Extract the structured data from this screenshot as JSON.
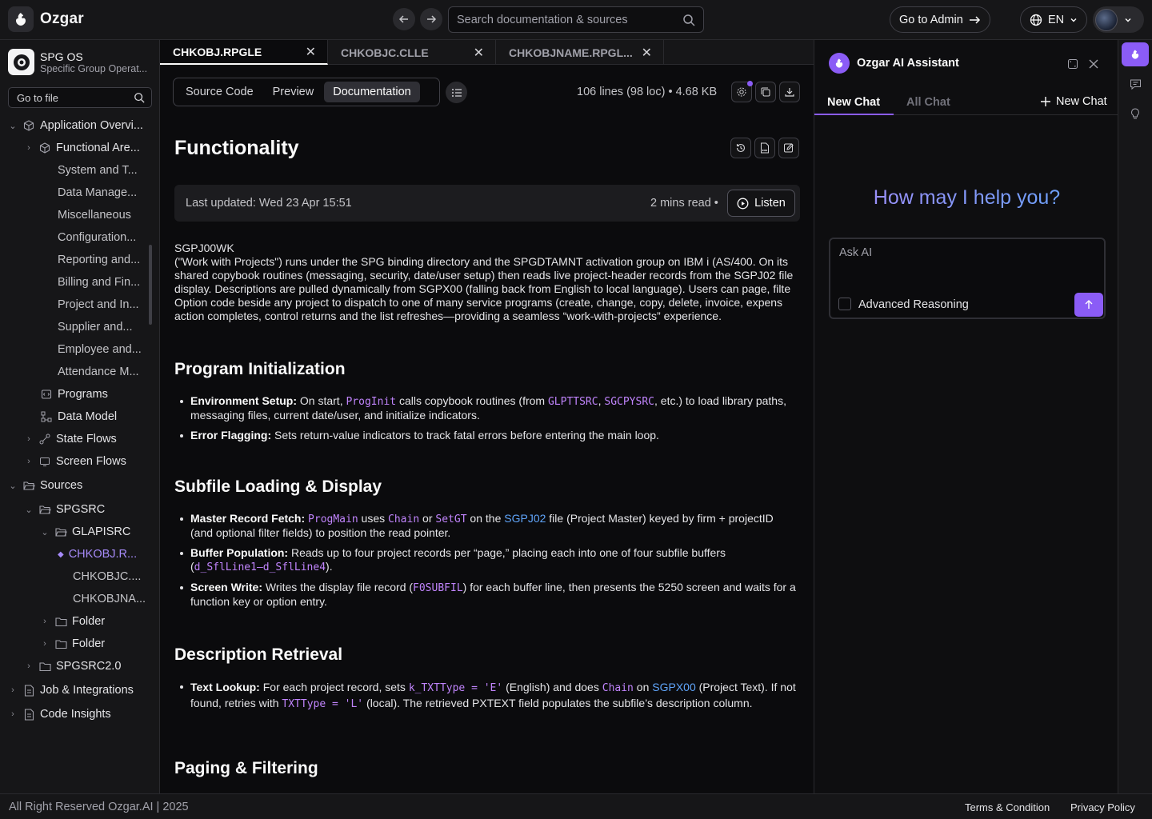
{
  "topbar": {
    "brand": "Ozgar",
    "search_placeholder": "Search documentation & sources",
    "admin_label": "Go to Admin",
    "lang_label": "EN"
  },
  "sidebar": {
    "project_title": "SPG OS",
    "project_subtitle": "Specific Group Operat...",
    "file_search_placeholder": "Go to file",
    "tree": [
      {
        "label": "Application Overvi...",
        "icon": "box-icon"
      },
      {
        "label": "Functional Are...",
        "icon": "box-icon"
      },
      {
        "label": "System and T..."
      },
      {
        "label": "Data Manage..."
      },
      {
        "label": "Miscellaneous"
      },
      {
        "label": "Configuration..."
      },
      {
        "label": "Reporting and..."
      },
      {
        "label": "Billing and Fin..."
      },
      {
        "label": "Project and In..."
      },
      {
        "label": "Supplier and..."
      },
      {
        "label": "Employee and..."
      },
      {
        "label": "Attendance M..."
      },
      {
        "label": "Programs",
        "icon": "code-file-icon"
      },
      {
        "label": "Data Model",
        "icon": "data-model-icon"
      },
      {
        "label": "State Flows",
        "icon": "state-flow-icon"
      },
      {
        "label": "Screen Flows",
        "icon": "screen-flow-icon"
      },
      {
        "label": "Sources",
        "icon": "folder-open-icon"
      },
      {
        "label": "SPGSRC",
        "icon": "folder-open-icon"
      },
      {
        "label": "GLAPISRC",
        "icon": "folder-open-icon"
      },
      {
        "label": "CHKOBJ.R..."
      },
      {
        "label": "CHKOBJC...."
      },
      {
        "label": "CHKOBJNA..."
      },
      {
        "label": "Folder",
        "icon": "folder-icon"
      },
      {
        "label": "Folder",
        "icon": "folder-icon"
      },
      {
        "label": "SPGSRC2.0",
        "icon": "folder-icon"
      },
      {
        "label": "Job & Integrations",
        "icon": "doc-icon"
      },
      {
        "label": "Code Insights",
        "icon": "doc-icon"
      }
    ]
  },
  "tabs": [
    {
      "label": "CHKOBJ.RPGLE"
    },
    {
      "label": "CHKOBJC.CLLE"
    },
    {
      "label": "CHKOBJNAME.RPGL..."
    }
  ],
  "view_toggle": [
    "Source Code",
    "Preview",
    "Documentation"
  ],
  "file_meta": {
    "lines": "106 lines (98 loc)",
    "size": "4.68 KB"
  },
  "doc": {
    "title": "Functionality",
    "last_updated": "Last updated: Wed 23 Apr 15:51",
    "read_time": "2 mins read",
    "listen": "Listen",
    "intro_link": "SGPJ00WK",
    "intro_lines": [
      "(\"Work with Projects\") runs under the SPG binding directory and the SPGDTAMNT activation group on IBM i (AS/400. On its",
      "shared copybook routines (messaging, security, date/user setup) then reads live project-header records from the SGPJ02 file",
      "display. Descriptions are pulled dynamically from SGPX00 (falling back from English to local language). Users can page, filte",
      "Option code beside any project to dispatch to one of many service programs (create, change, copy, delete, invoice, expens",
      "action completes, control returns and the list refreshes—providing a seamless “work-with-projects” experience."
    ],
    "sections": [
      {
        "heading": "Program Initialization"
      },
      {
        "heading": "Subfile Loading & Display"
      },
      {
        "heading": "Description Retrieval"
      },
      {
        "heading": "Paging & Filtering"
      }
    ],
    "s1": {
      "b1_label": "Environment Setup:",
      "b1_t1": " On start, ",
      "b1_c1": "ProgInit",
      "b1_t2": " calls copybook routines (from ",
      "b1_c2": "GLPTTSRC",
      "b1_t3": ", ",
      "b1_c3": "SGCPYSRC",
      "b1_t4": ", etc.) to load library paths, messaging files, current date/user, and initialize indicators.",
      "b2_label": "Error Flagging:",
      "b2_t1": " Sets return-value indicators to track fatal errors before entering the main loop."
    },
    "s2": {
      "b1_label": "Master Record Fetch:",
      "b1_c1": "ProgMain",
      "b1_t1": " uses ",
      "b1_c2": "Chain",
      "b1_t2": " or ",
      "b1_c3": "SetGT",
      "b1_t3": " on the ",
      "b1_l1": "SGPJ02",
      "b1_t4": " file (Project Master) keyed by firm + projectID (and optional filter fields) to position the read pointer.",
      "b2_label": "Buffer Population:",
      "b2_t1": " Reads up to four project records per “page,” placing each into one of four subfile buffers (",
      "b2_c1": "d_SflLine1–d_SflLine4",
      "b2_t2": ").",
      "b3_label": "Screen Write:",
      "b3_t1": " Writes the display file record (",
      "b3_c1": "F0SUBFIL",
      "b3_t2": ") for each buffer line, then presents the 5250 screen and waits for a function key or option entry."
    },
    "s3": {
      "b1_label": "Text Lookup:",
      "b1_t1": " For each project record, sets ",
      "b1_c1": "k_TXTType = 'E'",
      "b1_t2": " (English) and does ",
      "b1_c2": "Chain",
      "b1_t3": " on ",
      "b1_l1": "SGPX00",
      "b1_t4": " (Project Text). If not found, retries with ",
      "b1_c3": "TXTType = 'L'",
      "b1_t5": " (local). The retrieved PXTEXT field populates the subfile’s description column."
    }
  },
  "ai": {
    "title": "Ozgar AI Assistant",
    "tab_new": "New Chat",
    "tab_all": "All Chat",
    "new_chat_button": "New Chat",
    "greeting": "How may I help you?",
    "input_placeholder": "Ask AI",
    "advanced_reasoning": "Advanced Reasoning"
  },
  "footer": {
    "copyright": "All Right Reserved Ozgar.AI | 2025",
    "terms": "Terms & Condition",
    "privacy": "Privacy Policy"
  },
  "colors": {
    "accent": "#8b5cf6",
    "link": "#60a5fa",
    "code": "#c084fc",
    "background": "#0b0b0d"
  }
}
